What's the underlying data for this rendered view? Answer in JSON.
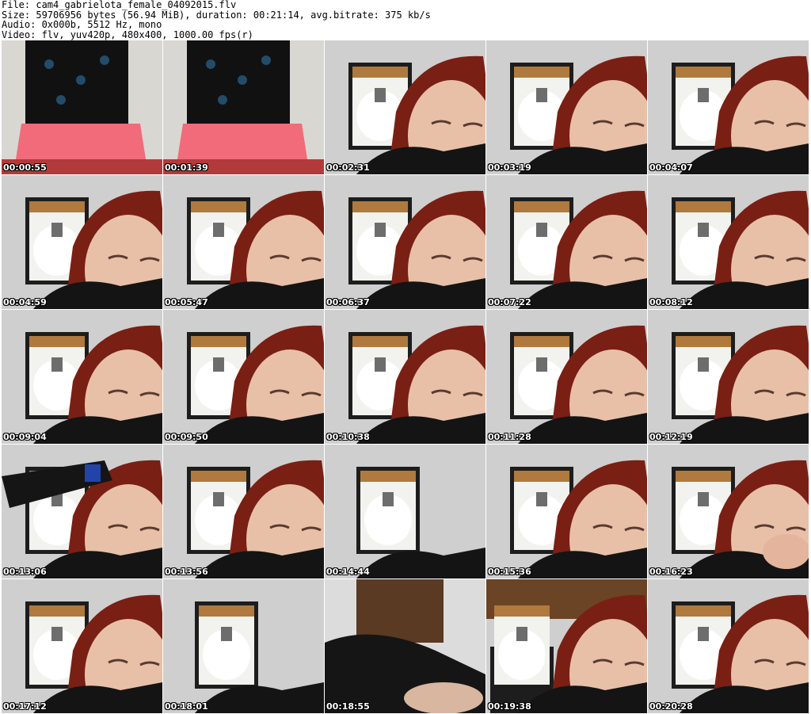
{
  "header": {
    "line1": "File: cam4_gabrielota_female_04092015.flv",
    "line2": "Size: 59706956 bytes (56.94 MiB), duration: 00:21:14, avg.bitrate: 375 kb/s",
    "line3": "Audio: 0x000b, 5512 Hz, mono",
    "line4": "Video: flv, yuv420p, 480x400, 1000.00 fps(r)"
  },
  "thumbnails": [
    {
      "time": "00:00:55",
      "scene": "pink-pants-front"
    },
    {
      "time": "00:01:39",
      "scene": "pink-pants-back"
    },
    {
      "time": "00:02:31",
      "scene": "face-frame"
    },
    {
      "time": "00:03:19",
      "scene": "face-frame"
    },
    {
      "time": "00:04:07",
      "scene": "face-frame"
    },
    {
      "time": "00:04:59",
      "scene": "face-frame"
    },
    {
      "time": "00:05:47",
      "scene": "face-frame"
    },
    {
      "time": "00:06:37",
      "scene": "face-frame"
    },
    {
      "time": "00:07:22",
      "scene": "face-frame"
    },
    {
      "time": "00:08:12",
      "scene": "face-frame"
    },
    {
      "time": "00:09:04",
      "scene": "face-frame"
    },
    {
      "time": "00:09:50",
      "scene": "face-frame"
    },
    {
      "time": "00:10:38",
      "scene": "face-frame"
    },
    {
      "time": "00:11:28",
      "scene": "face-frame"
    },
    {
      "time": "00:12:19",
      "scene": "face-frame"
    },
    {
      "time": "00:13:06",
      "scene": "face-arm"
    },
    {
      "time": "00:13:56",
      "scene": "face-frame"
    },
    {
      "time": "00:14:44",
      "scene": "frame-only"
    },
    {
      "time": "00:15:36",
      "scene": "face-frame"
    },
    {
      "time": "00:16:23",
      "scene": "face-hand"
    },
    {
      "time": "00:17:12",
      "scene": "face-frame"
    },
    {
      "time": "00:18:01",
      "scene": "frame-only"
    },
    {
      "time": "00:18:55",
      "scene": "dark-room"
    },
    {
      "time": "00:19:38",
      "scene": "face-ceiling"
    },
    {
      "time": "00:20:28",
      "scene": "face-frame"
    }
  ]
}
